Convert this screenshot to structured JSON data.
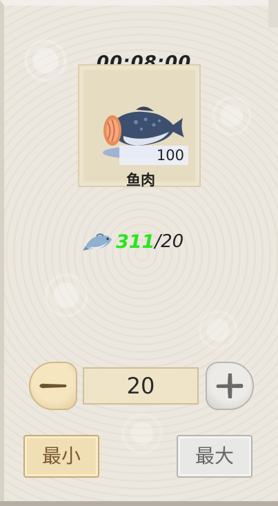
{
  "craft": {
    "timer": "00:08:00",
    "item": {
      "name": "鱼肉",
      "quantity": "100",
      "icon": "fish-meat-icon"
    }
  },
  "cost": {
    "icon": "fish-icon",
    "have": "311",
    "separator": "/",
    "need": "20"
  },
  "quantity_selector": {
    "value": "20",
    "decrease_icon": "minus-icon",
    "increase_icon": "plus-icon"
  },
  "buttons": {
    "min_label": "最小",
    "max_label": "最大"
  },
  "colors": {
    "have_amount": "#27e61d",
    "card_bg": "#e5dcc2",
    "min_button": "#f1dfb4",
    "max_button": "#e8e8e6"
  }
}
